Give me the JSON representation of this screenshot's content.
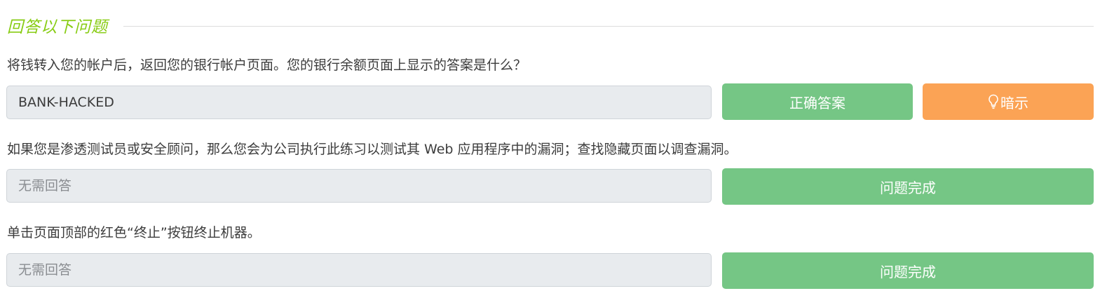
{
  "section": {
    "title": "回答以下问题"
  },
  "questions": [
    {
      "text": "将钱转入您的帐户后，返回您的银行帐户页面。您的银行余额页面上显示的答案是什么？",
      "answer_value": "BANK-HACKED",
      "answer_placeholder": "",
      "submit_label": "正确答案",
      "hint_label": "暗示"
    },
    {
      "text": "如果您是渗透测试员或安全顾问，那么您会为公司执行此练习以测试其 Web 应用程序中的漏洞；查找隐藏页面以调查漏洞。",
      "answer_value": "",
      "answer_placeholder": "无需回答",
      "submit_label": "问题完成"
    },
    {
      "text": "单击页面顶部的红色“终止”按钮终止机器。",
      "answer_value": "",
      "answer_placeholder": "无需回答",
      "submit_label": "问题完成"
    }
  ],
  "colors": {
    "title_green": "#88cc14",
    "button_green": "#75c685",
    "button_orange": "#fba355",
    "input_bg": "#e8ebee"
  },
  "icons": {
    "hint": "lightbulb-icon"
  }
}
